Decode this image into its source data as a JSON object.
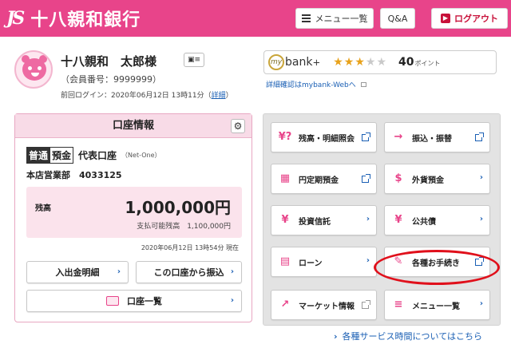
{
  "header": {
    "logo_mark": "JS",
    "bank_name": "十八親和銀行",
    "menu_label": "メニュー一覧",
    "qa_label": "Q&A",
    "logout_label": "ログアウト",
    "brand_color": "#e8448a"
  },
  "user": {
    "name": "十八親和　太郎様",
    "member_no": "（会員番号：9999999）",
    "last_login": "前回ログイン：2020年06月12日 13時11分（",
    "detail_link": "詳細",
    "last_login_close": "）"
  },
  "mybank": {
    "logo": "bank",
    "logo_prefix": "my",
    "logo_plus": "+",
    "stars_on": "★★★",
    "stars_off": "★★",
    "points": "40",
    "points_unit": "ポイント",
    "detail_link": "詳細確認はmybank-Webへ"
  },
  "account": {
    "panel_title": "口座情報",
    "tag1": "普通",
    "tag2": "預金",
    "label": "代表口座",
    "sub": "（Net-One）",
    "branch_no": "本店営業部　4033125",
    "balance_label": "残高",
    "balance": "1,000,000円",
    "available": "支払可能残高　1,100,000円",
    "as_of": "2020年06月12日 13時54分 現在",
    "btn_inout": "入出金明細",
    "btn_transfer": "この口座から振込",
    "btn_list": "口座一覧"
  },
  "menu": {
    "tiles": [
      {
        "label": "残高・明細照会",
        "icon": "¥?"
      },
      {
        "label": "振込・振替",
        "icon": "→"
      },
      {
        "label": "円定期預金",
        "icon": "▦"
      },
      {
        "label": "外貨預金",
        "icon": "$"
      },
      {
        "label": "投資信託",
        "icon": "¥"
      },
      {
        "label": "公共債",
        "icon": "¥"
      },
      {
        "label": "ローン",
        "icon": "▤"
      },
      {
        "label": "各種お手続き",
        "icon": "✎"
      },
      {
        "label": "マーケット情報",
        "icon": "↗"
      },
      {
        "label": "メニュー一覧",
        "icon": "≡"
      }
    ]
  },
  "footer": {
    "service_hours_link": "各種サービス時間についてはこちら"
  }
}
